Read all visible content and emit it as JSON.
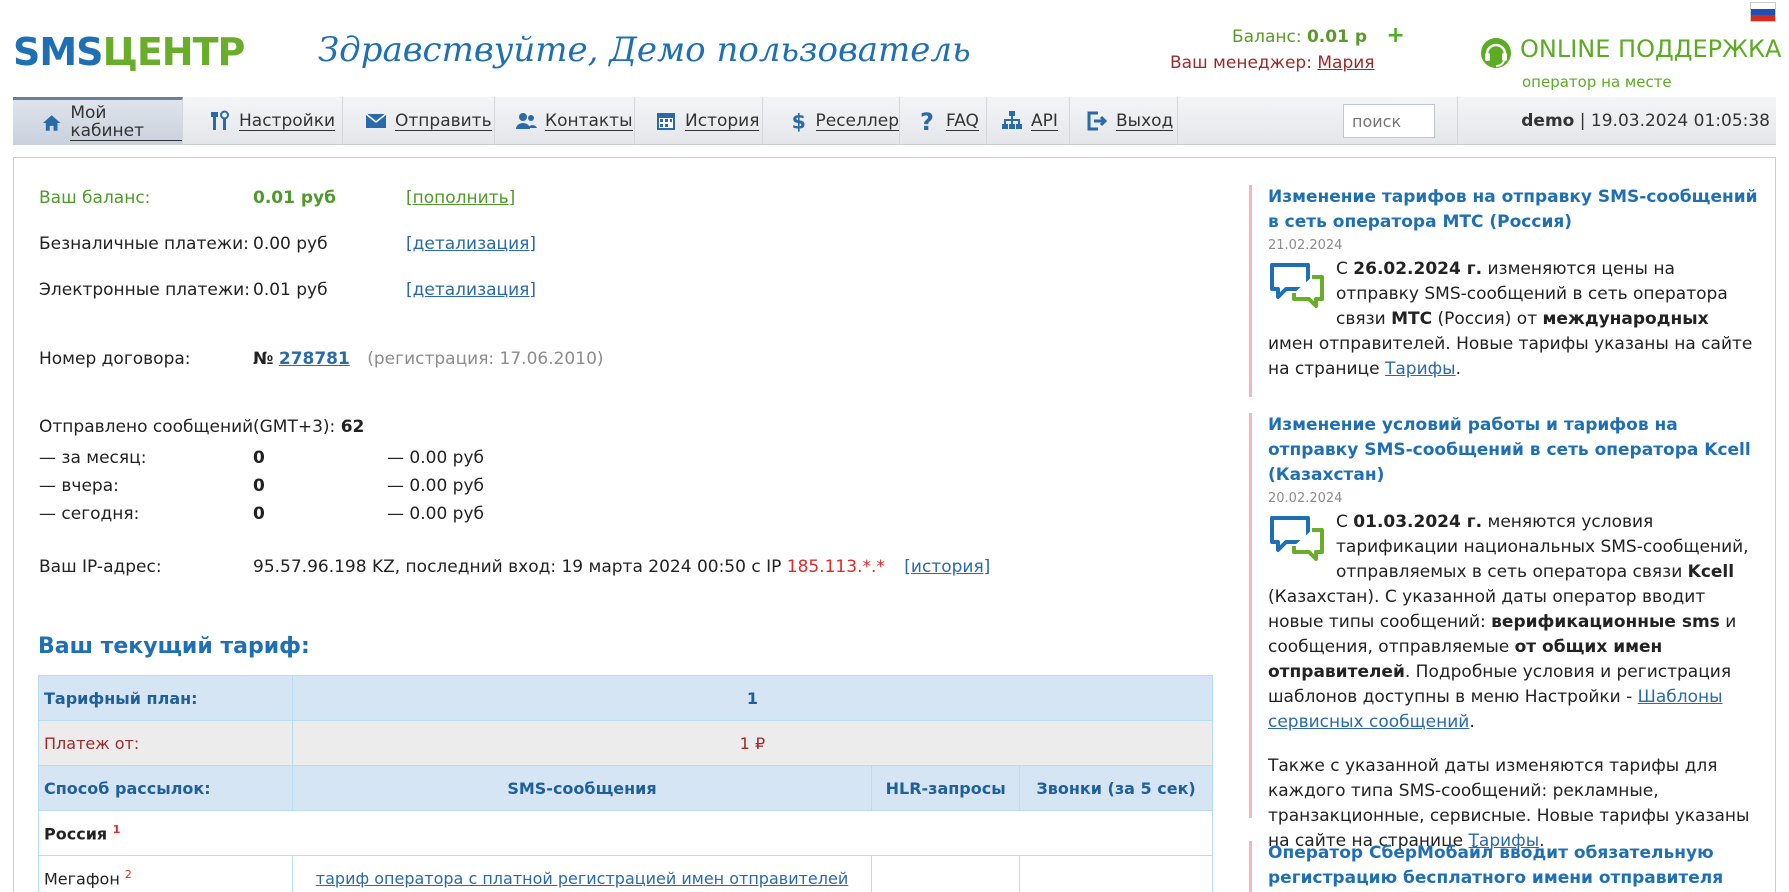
{
  "header": {
    "logo_sms": "SMS",
    "logo_centr": "ЦЕНТР",
    "greeting": "Здравствуйте, Демо пользователь",
    "balance_label": "Баланс:",
    "balance_value": "0.01 р",
    "manager_label": "Ваш менеджер:",
    "manager_name": "Мария",
    "support_title": "ONLINE ПОДДЕРЖКА",
    "support_sub": "оператор на месте"
  },
  "nav": {
    "items": [
      {
        "label": "Мой кабинет",
        "icon": "home-icon"
      },
      {
        "label": "Настройки",
        "icon": "tools-icon"
      },
      {
        "label": "Отправить",
        "icon": "envelope-icon"
      },
      {
        "label": "Контакты",
        "icon": "users-icon"
      },
      {
        "label": "История",
        "icon": "calendar-icon"
      },
      {
        "label": "Реселлер",
        "icon": "dollar-icon"
      },
      {
        "label": "FAQ",
        "icon": "question-icon"
      },
      {
        "label": "API",
        "icon": "sitemap-icon"
      },
      {
        "label": "Выход",
        "icon": "logout-icon"
      }
    ],
    "search_placeholder": "поиск",
    "user": "demo",
    "datetime": "19.03.2024 01:05:38"
  },
  "account": {
    "balance_label": "Ваш баланс:",
    "balance_value": "0.01 руб",
    "balance_link": "[пополнить]",
    "cashless_label": "Безналичные платежи:",
    "cashless_value": "0.00 руб",
    "cashless_link": "[детализация]",
    "electronic_label": "Электронные платежи:",
    "electronic_value": "0.01 руб",
    "electronic_link": "[детализация]",
    "contract_label": "Номер договора:",
    "contract_prefix": "№",
    "contract_number": "278781",
    "contract_reg": "(регистрация: 17.06.2010)",
    "sent_label": "Отправлено сообщений",
    "sent_tz": "(GMT+3):",
    "sent_total": "62",
    "month_label": "— за месяц:",
    "month_count": "0",
    "month_sum": "— 0.00 руб",
    "yesterday_label": "— вчера:",
    "yesterday_count": "0",
    "yesterday_sum": "— 0.00 руб",
    "today_label": "— сегодня:",
    "today_count": "0",
    "today_sum": "— 0.00 руб",
    "ip_label": "Ваш IP-адрес:",
    "ip_text": "95.57.96.198 KZ, последний вход: 19 марта 2024 00:50 с IP",
    "ip_last": "185.113.*.*",
    "ip_link": "[история]"
  },
  "tariff": {
    "title": "Ваш текущий тариф:",
    "plan_label": "Тарифный план:",
    "plan_value": "1",
    "payment_label": "Платеж от:",
    "payment_value": "1 ₽",
    "method_label": "Способ рассылок:",
    "col_sms": "SMS-сообщения",
    "col_hlr": "HLR-запросы",
    "col_calls": "Звонки (за 5 сек)",
    "country": "Россия",
    "country_note": "1",
    "operator": "Мегафон",
    "operator_note": "2",
    "operator_sms": "тариф оператора с платной регистрацией имен отправителей"
  },
  "news": [
    {
      "title": "Изменение тарифов на отправку SMS-сообщений в сеть оператора МТС (Россия)",
      "date": "21.02.2024",
      "p1": "С ",
      "b1": "26.02.2024 г.",
      "p2": " изменяются цены на отправку SMS-сообщений в сеть оператора связи ",
      "b2": "МТС",
      "p3": " (Россия) от ",
      "b3": "международных",
      "p4": " имен отправителей. Новые тарифы указаны на сайте на странице ",
      "link": "Тарифы",
      "p5": "."
    },
    {
      "title": "Изменение условий работы и тарифов на отправку SMS-сообщений в сеть оператора Kcell (Казахстан)",
      "date": "20.02.2024",
      "p1": "С ",
      "b1": "01.03.2024 г.",
      "p2": " меняются условия тарификации национальных SMS-сообщений, отправляемых в сеть оператора связи ",
      "b2": "Kcell",
      "p3": " (Казахстан). С указанной даты оператор вводит новые типы сообщений: ",
      "b3": "верификационные sms",
      "p4": " и сообщения, отправляемые ",
      "b4": "от общих имен отправителей",
      "p5": ". Подробные условия и регистрация шаблонов доступны в меню Настройки - ",
      "link": "Шаблоны сервисных сообщений",
      "p6": ".",
      "p7": "Также с указанной даты изменяются тарифы для каждого типа SMS-сообщений: рекламные, транзакционные, сервисные. Новые тарифы указаны на сайте на странице ",
      "link2": "Тарифы",
      "p8": "."
    },
    {
      "title": "Оператор СберМобайл вводит обязательную регистрацию бесплатного имени отправителя"
    }
  ],
  "colors": {
    "brand_blue": "#1f6fb5",
    "brand_green": "#6aad2b",
    "accent_red": "#e02a2a",
    "border_blue": "#a9d8ea"
  }
}
